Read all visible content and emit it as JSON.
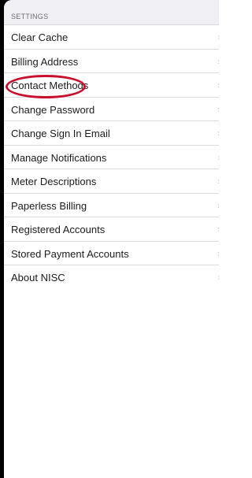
{
  "settings": {
    "section_title": "SETTINGS",
    "chevron_icon": "chevron-right-icon",
    "items": [
      {
        "label": "Clear Cache"
      },
      {
        "label": "Billing Address"
      },
      {
        "label": "Contact Methods"
      },
      {
        "label": "Change Password"
      },
      {
        "label": "Change Sign In Email"
      },
      {
        "label": "Manage Notifications"
      },
      {
        "label": "Meter Descriptions"
      },
      {
        "label": "Paperless Billing"
      },
      {
        "label": "Registered Accounts"
      },
      {
        "label": "Stored Payment Accounts"
      },
      {
        "label": "About NISC"
      }
    ]
  },
  "annotation": {
    "highlighted_item": "Contact Methods",
    "color": "#c8102e"
  }
}
